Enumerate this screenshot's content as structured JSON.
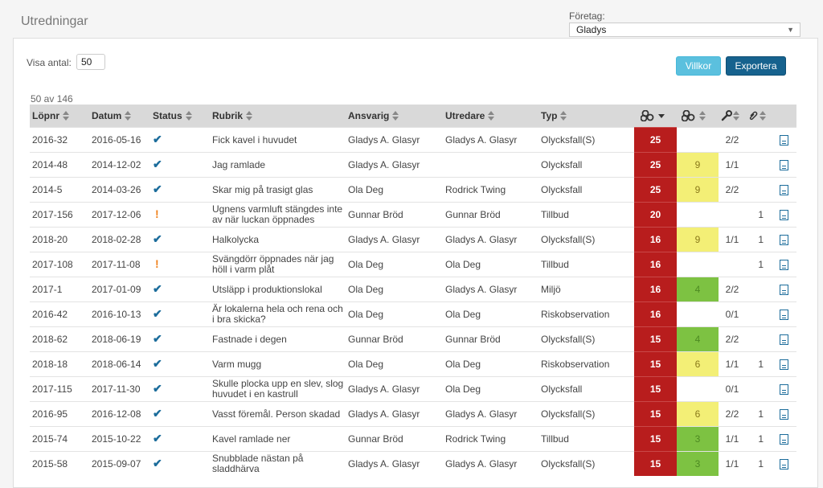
{
  "page": {
    "title": "Utredningar"
  },
  "company": {
    "label": "Företag:",
    "selected": "Gladys"
  },
  "controls": {
    "show_count_label": "Visa antal:",
    "show_count_value": "50",
    "terms_button": "Villkor",
    "export_button": "Exportera"
  },
  "table": {
    "result_count": "50 av 146",
    "headers": {
      "lopnr": "Löpnr",
      "datum": "Datum",
      "status": "Status",
      "rubrik": "Rubrik",
      "ansvarig": "Ansvarig",
      "utredare": "Utredare",
      "typ": "Typ"
    },
    "icon_headers": {
      "risk": "risk-icon",
      "score": "risk-reduced-icon",
      "actions": "tools-icon",
      "attachments": "paperclip-icon"
    },
    "colors": {
      "risk": "#b81d1d",
      "yellow": "#f3ef76",
      "green": "#7dc242",
      "accent": "#1b6c9b",
      "warning": "#f0831f"
    },
    "rows": [
      {
        "lopnr": "2016-32",
        "datum": "2016-05-16",
        "status": "done",
        "rubrik": "Fick kavel i huvudet",
        "ansvarig": "Gladys A. Glasyr",
        "utredare": "Gladys A. Glasyr",
        "typ": "Olycksfall(S)",
        "risk": "25",
        "score": "",
        "score_color": "",
        "actions": "2/2",
        "attachments": ""
      },
      {
        "lopnr": "2014-48",
        "datum": "2014-12-02",
        "status": "done",
        "rubrik": "Jag ramlade",
        "ansvarig": "Gladys A. Glasyr",
        "utredare": "",
        "typ": "Olycksfall",
        "risk": "25",
        "score": "9",
        "score_color": "yellow",
        "actions": "1/1",
        "attachments": ""
      },
      {
        "lopnr": "2014-5",
        "datum": "2014-03-26",
        "status": "done",
        "rubrik": "Skar mig på trasigt glas",
        "ansvarig": "Ola Deg",
        "utredare": "Rodrick Twing",
        "typ": "Olycksfall",
        "risk": "25",
        "score": "9",
        "score_color": "yellow",
        "actions": "2/2",
        "attachments": ""
      },
      {
        "lopnr": "2017-156",
        "datum": "2017-12-06",
        "status": "warning",
        "rubrik": "Ugnens varmluft stängdes inte av när luckan öppnades",
        "ansvarig": "Gunnar Bröd",
        "utredare": "Gunnar Bröd",
        "typ": "Tillbud",
        "risk": "20",
        "score": "",
        "score_color": "",
        "actions": "",
        "attachments": "1"
      },
      {
        "lopnr": "2018-20",
        "datum": "2018-02-28",
        "status": "done",
        "rubrik": "Halkolycka",
        "ansvarig": "Gladys A. Glasyr",
        "utredare": "Gladys A. Glasyr",
        "typ": "Olycksfall(S)",
        "risk": "16",
        "score": "9",
        "score_color": "yellow",
        "actions": "1/1",
        "attachments": "1"
      },
      {
        "lopnr": "2017-108",
        "datum": "2017-11-08",
        "status": "warning",
        "rubrik": "Svängdörr öppnades när jag höll i varm plåt",
        "ansvarig": "Ola Deg",
        "utredare": "Ola Deg",
        "typ": "Tillbud",
        "risk": "16",
        "score": "",
        "score_color": "",
        "actions": "",
        "attachments": "1"
      },
      {
        "lopnr": "2017-1",
        "datum": "2017-01-09",
        "status": "done",
        "rubrik": "Utsläpp i produktionslokal",
        "ansvarig": "Ola Deg",
        "utredare": "Gladys A. Glasyr",
        "typ": "Miljö",
        "risk": "16",
        "score": "4",
        "score_color": "green",
        "actions": "2/2",
        "attachments": ""
      },
      {
        "lopnr": "2016-42",
        "datum": "2016-10-13",
        "status": "done",
        "rubrik": "Är lokalerna hela och rena och i bra skicka?",
        "ansvarig": "Ola Deg",
        "utredare": "Ola Deg",
        "typ": "Riskobservation",
        "risk": "16",
        "score": "",
        "score_color": "",
        "actions": "0/1",
        "attachments": ""
      },
      {
        "lopnr": "2018-62",
        "datum": "2018-06-19",
        "status": "done",
        "rubrik": "Fastnade i degen",
        "ansvarig": "Gunnar Bröd",
        "utredare": "Gunnar Bröd",
        "typ": "Olycksfall(S)",
        "risk": "15",
        "score": "4",
        "score_color": "green",
        "actions": "2/2",
        "attachments": ""
      },
      {
        "lopnr": "2018-18",
        "datum": "2018-06-14",
        "status": "done",
        "rubrik": "Varm mugg",
        "ansvarig": "Ola Deg",
        "utredare": "Ola Deg",
        "typ": "Riskobservation",
        "risk": "15",
        "score": "6",
        "score_color": "yellow",
        "actions": "1/1",
        "attachments": "1"
      },
      {
        "lopnr": "2017-115",
        "datum": "2017-11-30",
        "status": "done",
        "rubrik": "Skulle plocka upp en slev, slog huvudet i en kastrull",
        "ansvarig": "Gladys A. Glasyr",
        "utredare": "Ola Deg",
        "typ": "Olycksfall",
        "risk": "15",
        "score": "",
        "score_color": "",
        "actions": "0/1",
        "attachments": ""
      },
      {
        "lopnr": "2016-95",
        "datum": "2016-12-08",
        "status": "done",
        "rubrik": "Vasst föremål. Person skadad",
        "ansvarig": "Gladys A. Glasyr",
        "utredare": "Gladys A. Glasyr",
        "typ": "Olycksfall(S)",
        "risk": "15",
        "score": "6",
        "score_color": "yellow",
        "actions": "2/2",
        "attachments": "1"
      },
      {
        "lopnr": "2015-74",
        "datum": "2015-10-22",
        "status": "done",
        "rubrik": "Kavel ramlade ner",
        "ansvarig": "Gunnar Bröd",
        "utredare": "Rodrick Twing",
        "typ": "Tillbud",
        "risk": "15",
        "score": "3",
        "score_color": "green",
        "actions": "1/1",
        "attachments": "1"
      },
      {
        "lopnr": "2015-58",
        "datum": "2015-09-07",
        "status": "done",
        "rubrik": "Snubblade nästan på sladdhärva",
        "ansvarig": "Gladys A. Glasyr",
        "utredare": "Gladys A. Glasyr",
        "typ": "Olycksfall(S)",
        "risk": "15",
        "score": "3",
        "score_color": "green",
        "actions": "1/1",
        "attachments": "1"
      }
    ]
  }
}
